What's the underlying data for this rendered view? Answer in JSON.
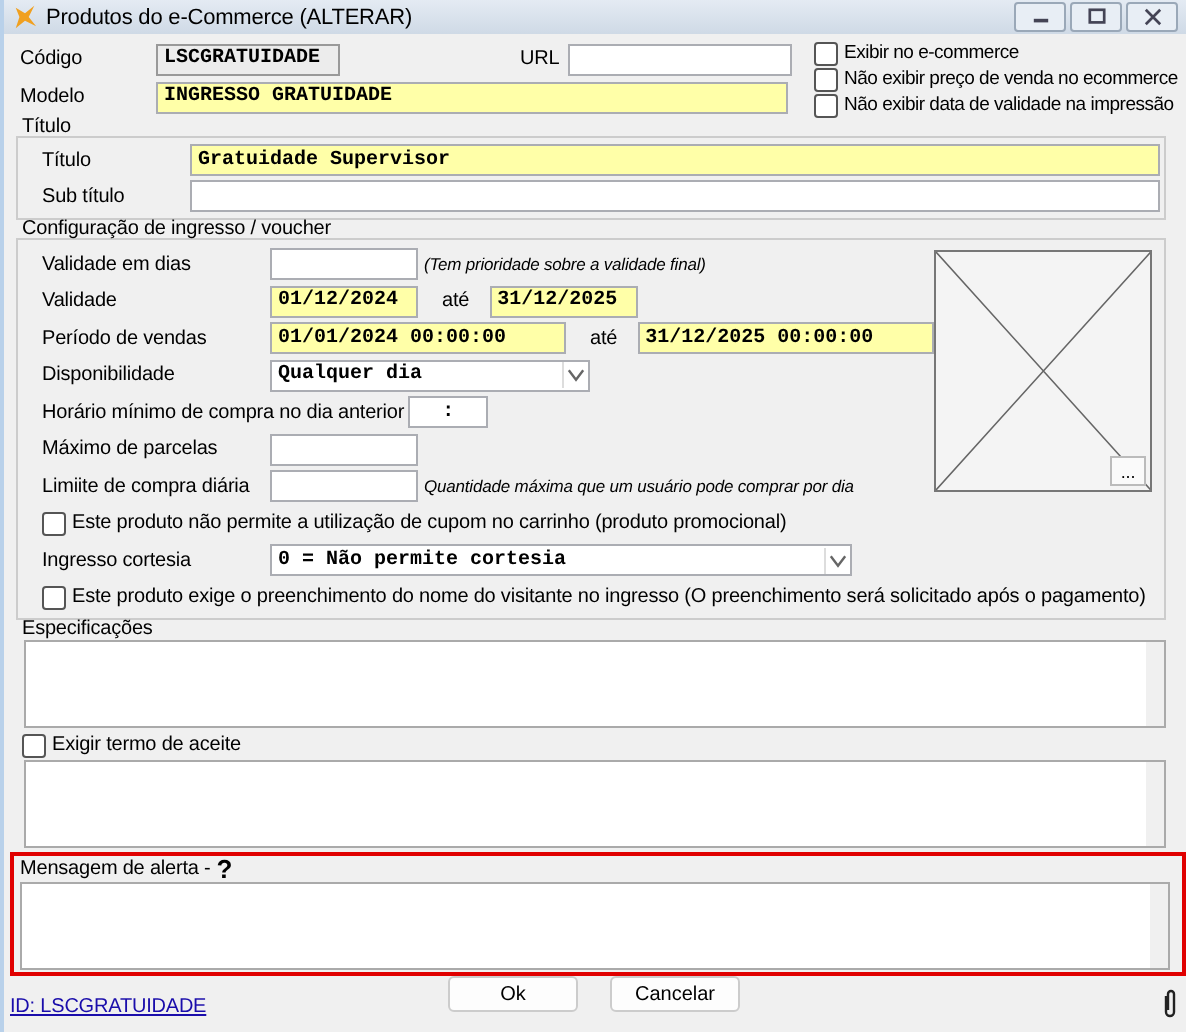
{
  "window": {
    "title": "Produtos do e-Commerce (ALTERAR)"
  },
  "codigo": {
    "label": "Código",
    "value": "LSCGRATUIDADE",
    "disabled": true
  },
  "url": {
    "label": "URL"
  },
  "modelo": {
    "label": "Modelo",
    "value": "INGRESSO GRATUIDADE",
    "required": true
  },
  "options": [
    {
      "label": "Exibir no e-commerce",
      "checked": false
    },
    {
      "label": "Não exibir preço de venda no ecommerce",
      "checked": false
    },
    {
      "label": "Não exibir data de validade na impressão",
      "checked": false
    }
  ],
  "titulo_group": {
    "title": "Título",
    "fields": [
      {
        "label": "Título",
        "value": "Gratuidade Supervisor",
        "required": true
      },
      {
        "label": "Sub título",
        "required": false
      }
    ]
  },
  "config": {
    "title": "Configuração de ingresso / voucher",
    "rows": [
      {
        "kind": "input",
        "label": "Validade em dias",
        "inputs": [
          {
            "kind": "short",
            "required": false
          }
        ],
        "hint": "(Tem prioridade sobre a validade final)"
      },
      {
        "kind": "range",
        "label": "Validade",
        "inputs": [
          {
            "kind": "short",
            "value": "01/12/2024",
            "required": true
          },
          {
            "kind": "short",
            "value": "31/12/2025",
            "required": true
          }
        ],
        "separator": "até"
      },
      {
        "kind": "range",
        "label": "Período de vendas",
        "inputs": [
          {
            "kind": "long",
            "value": "01/01/2024 00:00:00",
            "required": true
          },
          {
            "kind": "long",
            "value": "31/12/2025 00:00:00",
            "required": true
          }
        ],
        "separator": "até"
      },
      {
        "kind": "select",
        "label": "Disponibilidade",
        "value": "Qualquer dia"
      },
      {
        "kind": "input",
        "label": "Horário mínimo de compra no dia anterior",
        "inputs": [
          {
            "kind": "time",
            "value": ":",
            "required": false
          }
        ]
      },
      {
        "kind": "input",
        "label": "Máximo de parcelas",
        "inputs": [
          {
            "kind": "short",
            "required": false
          }
        ]
      },
      {
        "kind": "input",
        "label": "Limiite de compra diária",
        "inputs": [
          {
            "kind": "short",
            "required": false
          }
        ],
        "hint": "Quantidade máxima que um usuário pode comprar por dia"
      }
    ],
    "image_button": "...",
    "more_rows": [
      {
        "kind": "checkbox",
        "label": "Este produto não permite a utilização de cupom no carrinho (produto promocional)",
        "checked": false
      },
      {
        "kind": "select",
        "label": "Ingresso cortesia",
        "value": "0 = Não permite cortesia"
      },
      {
        "kind": "checkbox",
        "label": "Este produto exige o preenchimento do nome do visitante no ingresso (O preenchimento será solicitado após o pagamento)",
        "checked": false
      }
    ]
  },
  "especificacoes": {
    "label": "Especificações"
  },
  "termo": {
    "label": "Exigir termo de aceite",
    "checked": false
  },
  "alerta": {
    "label": "Mensagem de alerta -",
    "help": "?",
    "highlighted": true
  },
  "buttons": [
    {
      "label": "Ok"
    },
    {
      "label": "Cancelar"
    }
  ],
  "footer_link": "ID: LSCGRATUIDADE"
}
